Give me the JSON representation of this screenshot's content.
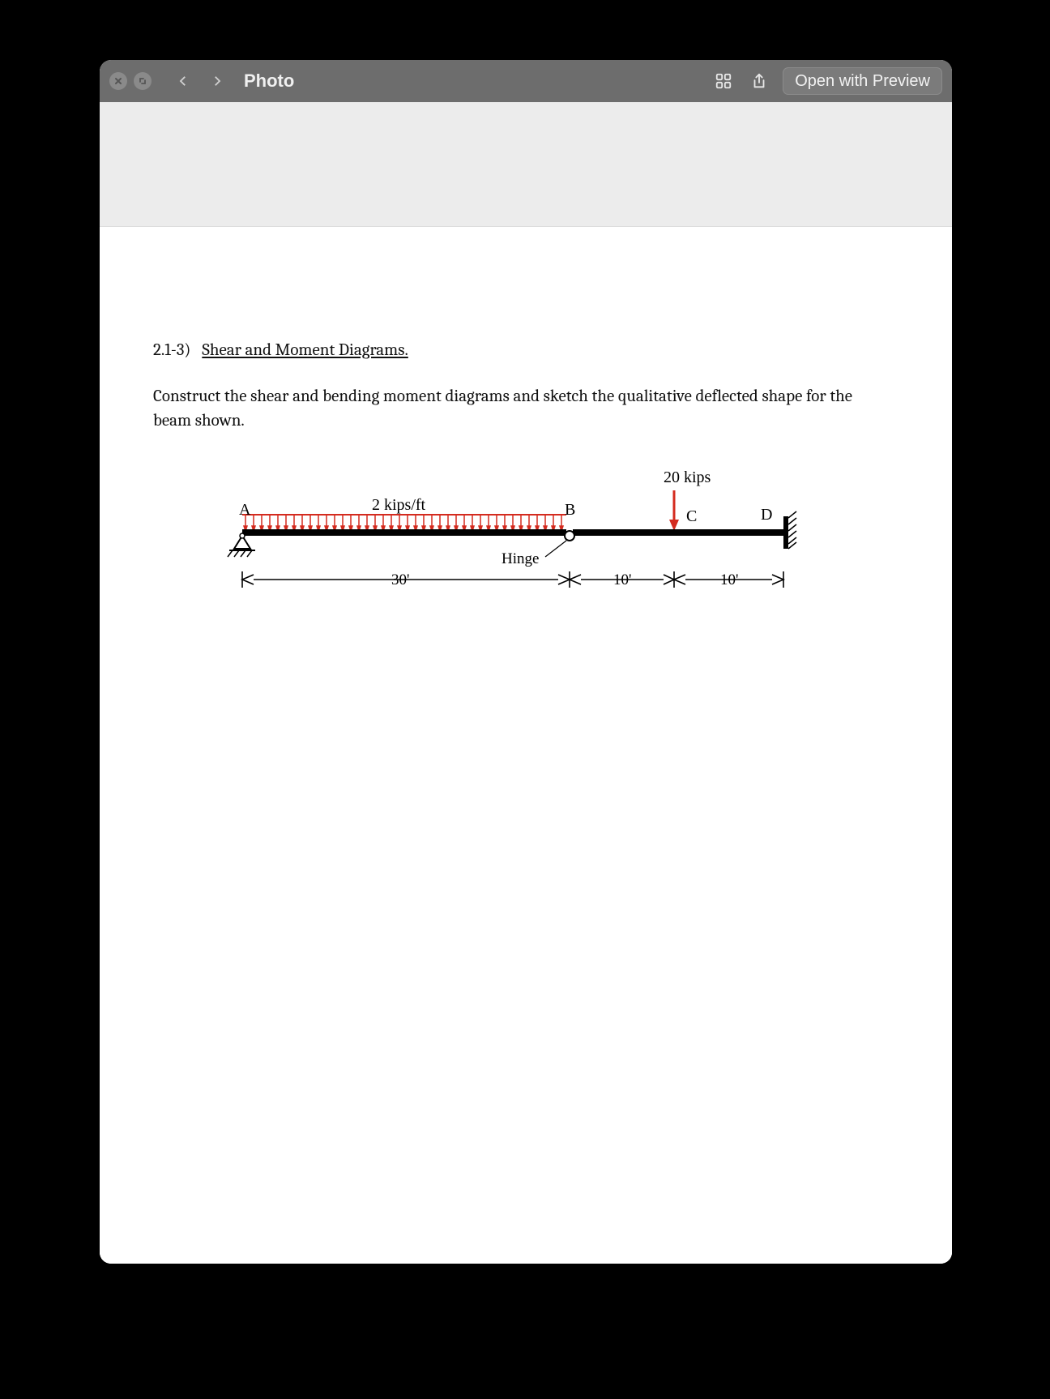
{
  "titlebar": {
    "title": "Photo",
    "open_button_label": "Open with Preview"
  },
  "document": {
    "problem_number": "2.1-3)",
    "problem_title": "Shear and Moment Diagrams.",
    "problem_statement": "Construct the shear and bending moment diagrams and sketch the qualitative deflected shape for the beam shown.",
    "diagram": {
      "point_load_label": "20 kips",
      "distributed_load_label": "2 kips/ft",
      "hinge_label": "Hinge",
      "nodes": {
        "A": "A",
        "B": "B",
        "C": "C",
        "D": "D"
      },
      "dimensions": {
        "d30": "30'",
        "d10a": "10'",
        "d10b": "10'"
      }
    }
  }
}
